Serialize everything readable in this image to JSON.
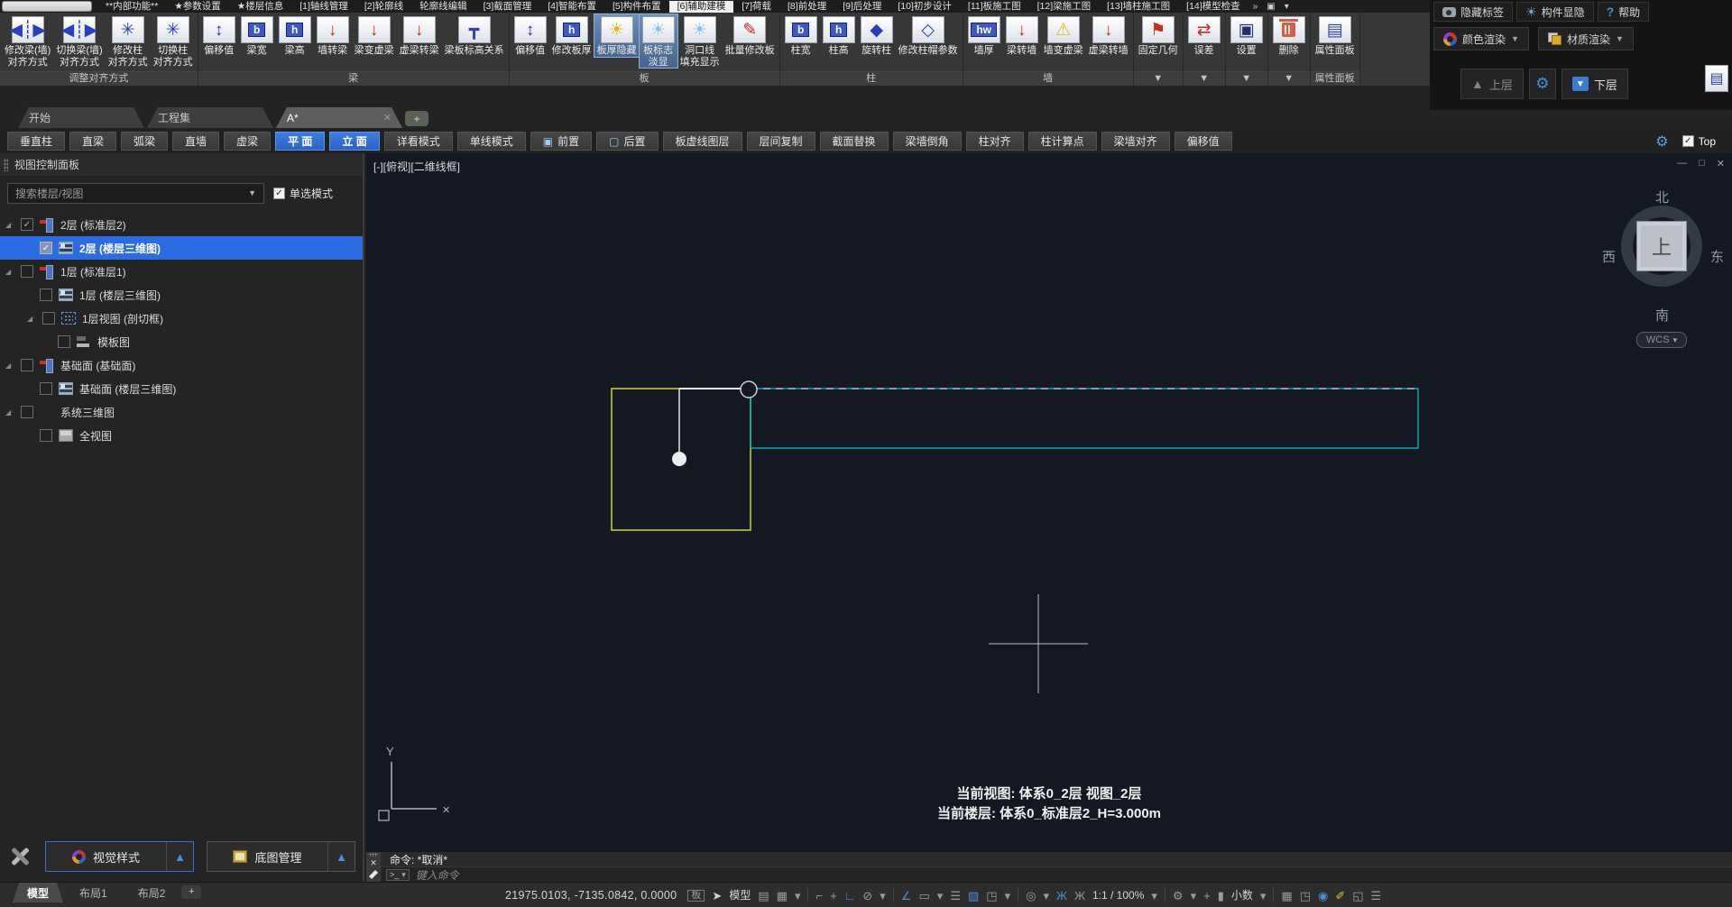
{
  "menu": {
    "items": [
      "**内部功能**",
      "★参数设置",
      "★楼层信息",
      "[1]轴线管理",
      "[2]轮廓线",
      "轮廓线编辑",
      "[3]截面管理",
      "[4]智能布置",
      "[5]构件布置",
      "[6]辅助建模",
      "[7]荷载",
      "[8]前处理",
      "[9]后处理",
      "[10]初步设计",
      "[11]板施工图",
      "[12]梁施工图",
      "[13]墙柱施工图",
      "[14]模型检查"
    ],
    "more_icon": "»",
    "window_icon": "▣",
    "window_caret": "▾"
  },
  "right_zone": {
    "hide_tags": "隐藏标签",
    "component_visibility": "构件显隐",
    "help": "帮助",
    "help_icon": "?",
    "bulb_icon": "☀",
    "color_render": "颜色渲染",
    "material_render": "材质渲染",
    "caret": "▼",
    "upper_floor": "上层",
    "lower_floor": "下层",
    "upper_icon": "▲",
    "lower_icon": "▼",
    "gear_icon": "⚙",
    "flyout_icon": "▤"
  },
  "ribbon": {
    "groups": [
      {
        "label": "调整对齐方式",
        "items": [
          {
            "label": "修改梁(墙)\n对齐方式",
            "glyph": "◀┊▶",
            "color": "blue"
          },
          {
            "label": "切换梁(墙)\n对齐方式",
            "glyph": "◀┊▶",
            "color": "blue"
          },
          {
            "label": "修改柱\n对齐方式",
            "glyph": "✳",
            "color": "blue"
          },
          {
            "label": "切换柱\n对齐方式",
            "glyph": "✳",
            "color": "blue"
          }
        ]
      },
      {
        "label": "梁",
        "items": [
          {
            "label": "偏移值",
            "glyph": "↕",
            "color": "blue"
          },
          {
            "label": "梁宽",
            "glyph": "b",
            "variant": "boxed"
          },
          {
            "label": "梁高",
            "glyph": "h",
            "variant": "boxed"
          },
          {
            "label": "墙转梁",
            "glyph": "↓",
            "color": "red"
          },
          {
            "label": "梁变虚梁",
            "glyph": "↓",
            "color": "red"
          },
          {
            "label": "虚梁转梁",
            "glyph": "↓",
            "color": "red"
          },
          {
            "label": "梁板标高关系",
            "glyph": "┳",
            "color": "blue"
          }
        ]
      },
      {
        "label": "板",
        "items": [
          {
            "label": "偏移值",
            "glyph": "↕",
            "color": "blue"
          },
          {
            "label": "修改板厚",
            "glyph": "h",
            "variant": "boxed"
          },
          {
            "label": "板厚隐藏",
            "glyph": "☀",
            "color": "yellow"
          },
          {
            "label": "板标志\n淡显",
            "glyph": "☀",
            "color": "lightblue"
          },
          {
            "label": "洞口线\n填充显示",
            "glyph": "☀",
            "color": "lightblue"
          },
          {
            "label": "批量修改板",
            "glyph": "✎",
            "color": "red"
          }
        ]
      },
      {
        "label": "柱",
        "items": [
          {
            "label": "柱宽",
            "glyph": "b",
            "variant": "boxed"
          },
          {
            "label": "柱高",
            "glyph": "h",
            "variant": "boxed"
          },
          {
            "label": "旋转柱",
            "glyph": "◆",
            "color": "blue"
          },
          {
            "label": "修改柱帽参数",
            "glyph": "◇",
            "color": "blue"
          }
        ]
      },
      {
        "label": "墙",
        "items": [
          {
            "label": "墙厚",
            "glyph": "hw",
            "variant": "boxed"
          },
          {
            "label": "梁转墙",
            "glyph": "↓",
            "color": "red"
          },
          {
            "label": "墙变虚梁",
            "glyph": "⚠",
            "color": "yellow"
          },
          {
            "label": "虚梁转墙",
            "glyph": "↓",
            "color": "red"
          }
        ]
      },
      {
        "label": "▼",
        "items": [
          {
            "label": "固定几何",
            "glyph": "⚑",
            "color": "red"
          }
        ]
      },
      {
        "label": "▼",
        "items": [
          {
            "label": "误差",
            "glyph": "⇄",
            "color": "red"
          }
        ]
      },
      {
        "label": "▼",
        "items": [
          {
            "label": "设置",
            "glyph": "▣",
            "color": "navy"
          }
        ]
      },
      {
        "label": "▼",
        "items": [
          {
            "label": "删除",
            "glyph": "",
            "variant": "trash"
          }
        ]
      },
      {
        "label": "属性面板",
        "items": [
          {
            "label": "属性面板",
            "glyph": "▤",
            "color": "blue"
          }
        ]
      }
    ]
  },
  "doc_tabs": {
    "tabs": [
      "开始",
      "工程集",
      "A*"
    ],
    "close": "✕",
    "add": "+"
  },
  "toolbar": {
    "buttons": [
      {
        "label": "垂直柱"
      },
      {
        "label": "直梁"
      },
      {
        "label": "弧梁"
      },
      {
        "label": "直墙"
      },
      {
        "label": "虚梁"
      },
      {
        "label": "平 面"
      },
      {
        "label": "立 面"
      },
      {
        "label": "详看模式"
      },
      {
        "label": "单线模式"
      },
      {
        "label": "前置",
        "icon_glyph": "▣"
      },
      {
        "label": "后置",
        "icon_glyph": "▢"
      },
      {
        "label": "板虚线图层"
      },
      {
        "label": "层间复制"
      },
      {
        "label": "截面替换"
      },
      {
        "label": "梁墙倒角"
      },
      {
        "label": "柱对齐"
      },
      {
        "label": "柱计算点"
      },
      {
        "label": "梁墙对齐"
      },
      {
        "label": "偏移值"
      }
    ],
    "gear_icon": "⚙",
    "top_check": "✓",
    "top_label": "Top"
  },
  "sidebar": {
    "title": "视图控制面板",
    "search_placeholder": "搜索楼层/视图",
    "search_caret": "▼",
    "single_mode_check": "✓",
    "single_mode": "单选模式",
    "tree": [
      {
        "label": "2层  (标准层2)"
      },
      {
        "label": "2层  (楼层三维图)"
      },
      {
        "label": "1层  (标准层1)"
      },
      {
        "label": "1层  (楼层三维图)"
      },
      {
        "label": "1层视图  (剖切框)"
      },
      {
        "label": "模板图"
      },
      {
        "label": "基础面  (基础面)"
      },
      {
        "label": "基础面  (楼层三维图)"
      },
      {
        "label": "系统三维图"
      },
      {
        "label": "全视图"
      }
    ],
    "visual_style": "视觉样式",
    "base_map": "底图管理",
    "panel_up_icon": "▲"
  },
  "canvas": {
    "viewport_label": "[-][俯视][二维线框]",
    "window_controls": {
      "minimize": "—",
      "maximize": "□",
      "close": "✕"
    },
    "compass": {
      "north": "北",
      "south": "南",
      "east": "东",
      "west": "西",
      "center": "上",
      "wcs": "WCS",
      "wcs_caret": "▾"
    },
    "ucs": {
      "y_label": "Y",
      "x_label": "✕"
    },
    "status_line1": "当前视图: 体系0_2层 视图_2层",
    "status_line2": "当前楼层: 体系0_标准层2_H=3.000m"
  },
  "command": {
    "history": "命令: *取消*",
    "close": "✕",
    "prompt_icon": ">_",
    "prompt_caret": "▾",
    "placeholder": "键入命令"
  },
  "statusbar": {
    "layout_tabs": [
      "模型",
      "布局1",
      "布局2"
    ],
    "add_tab": "+",
    "coords": "21975.0103, -7135.0842, 0.0000",
    "icons": [
      {
        "name": "slab-lock",
        "glyph": "板",
        "color": "grey"
      },
      {
        "name": "cursor",
        "glyph": "➤",
        "color": "white"
      },
      {
        "name": "model-space",
        "glyph": "模型",
        "color": "white"
      },
      {
        "name": "grid-display",
        "glyph": "▤",
        "color": "grey"
      },
      {
        "name": "grid-snap",
        "glyph": "▦",
        "color": "grey"
      },
      {
        "name": "grid-caret",
        "glyph": "▾",
        "color": "grey"
      },
      {
        "name": "snap-mode",
        "glyph": "⌐",
        "color": "grey"
      },
      {
        "name": "snap-add",
        "glyph": "+",
        "color": "grey"
      },
      {
        "name": "ortho",
        "glyph": "∟",
        "color": "blue"
      },
      {
        "name": "polar",
        "glyph": "⊘",
        "color": "grey"
      },
      {
        "name": "polar-caret",
        "glyph": "▾",
        "color": "grey"
      },
      {
        "name": "object-snap",
        "glyph": "∠",
        "color": "blue"
      },
      {
        "name": "osnap-box",
        "glyph": "▭",
        "color": "grey"
      },
      {
        "name": "osnap-caret",
        "glyph": "▾",
        "color": "grey"
      },
      {
        "name": "lineweight",
        "glyph": "☰",
        "color": "grey"
      },
      {
        "name": "hatch",
        "glyph": "▨",
        "color": "blue"
      },
      {
        "name": "transparency",
        "glyph": "◳",
        "color": "grey"
      },
      {
        "name": "transparency-caret",
        "glyph": "▾",
        "color": "grey"
      },
      {
        "name": "dynamic-ucs",
        "glyph": "◎",
        "color": "grey"
      },
      {
        "name": "ucs-caret",
        "glyph": "▾",
        "color": "grey"
      },
      {
        "name": "annotation-vis",
        "glyph": "Ж",
        "color": "blue"
      },
      {
        "name": "annotation-auto",
        "glyph": "Ж",
        "color": "grey"
      },
      {
        "name": "annotation-scale",
        "glyph": "1:1 / 100%",
        "color": "white"
      },
      {
        "name": "scale-caret",
        "glyph": "▾",
        "color": "grey"
      },
      {
        "name": "workspace-gear",
        "glyph": "⚙",
        "color": "grey"
      },
      {
        "name": "gear-caret",
        "glyph": "▾",
        "color": "grey"
      },
      {
        "name": "crosshair",
        "glyph": "+",
        "color": "grey"
      },
      {
        "name": "units",
        "glyph": "▮",
        "color": "grey"
      },
      {
        "name": "units-label",
        "glyph": "小数",
        "color": "white"
      },
      {
        "name": "units-caret",
        "glyph": "▾",
        "color": "grey"
      },
      {
        "name": "calculator",
        "glyph": "▦",
        "color": "grey"
      },
      {
        "name": "lock-ui",
        "glyph": "◳",
        "color": "grey"
      },
      {
        "name": "isolate",
        "glyph": "◉",
        "color": "blue"
      },
      {
        "name": "cleanscreen",
        "glyph": "✐",
        "color": "yellow"
      },
      {
        "name": "fullscreen",
        "glyph": "◱",
        "color": "grey"
      },
      {
        "name": "menu",
        "glyph": "☰",
        "color": "grey"
      }
    ]
  }
}
